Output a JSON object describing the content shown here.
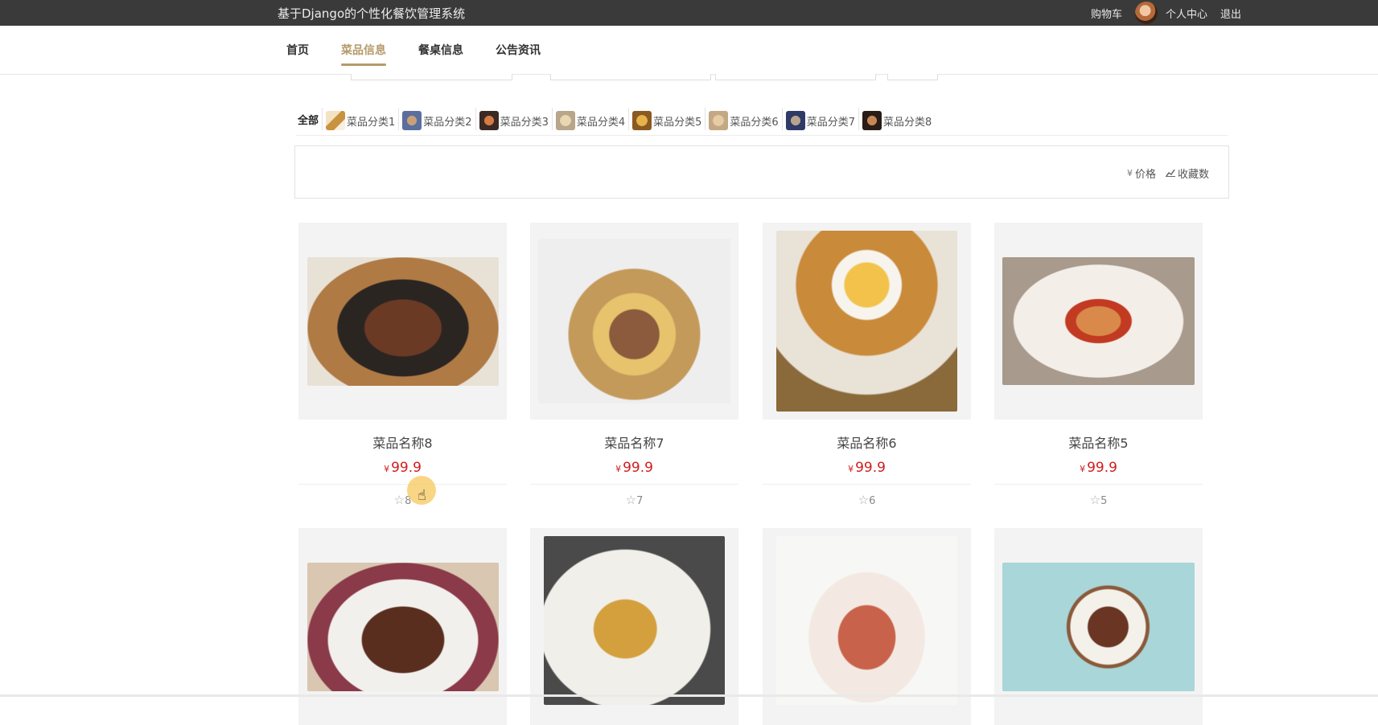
{
  "header": {
    "title": "基于Django的个性化餐饮管理系统",
    "cart": "购物车",
    "profile": "个人中心",
    "logout": "退出"
  },
  "nav": {
    "items": [
      "首页",
      "菜品信息",
      "餐桌信息",
      "公告资讯"
    ],
    "active": "菜品信息"
  },
  "categories": {
    "all": "全部",
    "items": [
      "菜品分类1",
      "菜品分类2",
      "菜品分类3",
      "菜品分类4",
      "菜品分类5",
      "菜品分类6",
      "菜品分类7",
      "菜品分类8"
    ]
  },
  "sort": {
    "price": "价格",
    "favorites": "收藏数",
    "price_icon": "yen-icon",
    "favorites_icon": "chart-icon"
  },
  "currency": "¥",
  "products": [
    {
      "name": "菜品名称8",
      "price": "99.9",
      "favorites": "8"
    },
    {
      "name": "菜品名称7",
      "price": "99.9",
      "favorites": "7"
    },
    {
      "name": "菜品名称6",
      "price": "99.9",
      "favorites": "6"
    },
    {
      "name": "菜品名称5",
      "price": "99.9",
      "favorites": "5"
    }
  ],
  "colors": {
    "topbar": "#3a3a3a",
    "accent": "#b49a6a",
    "price": "#d11c1c"
  }
}
